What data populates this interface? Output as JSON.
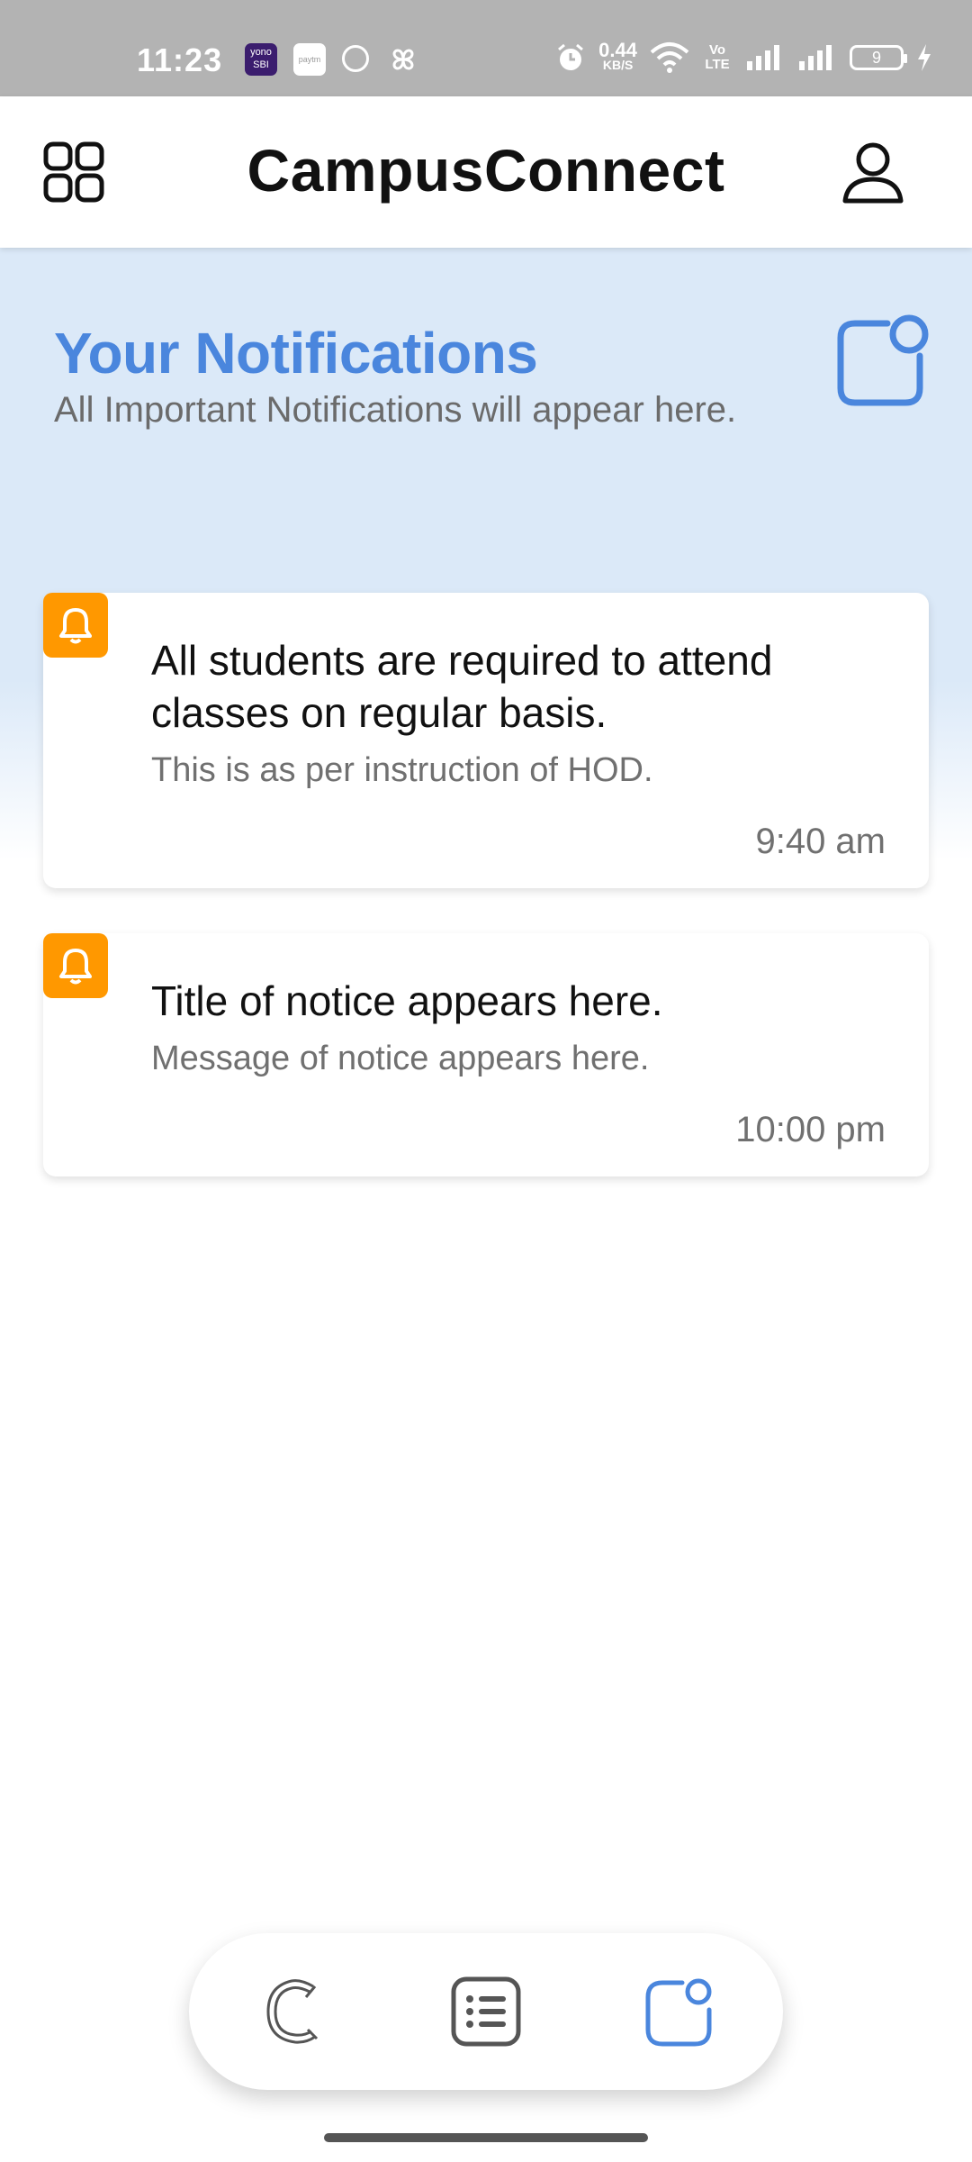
{
  "status_bar": {
    "time": "11:23",
    "yono_label": "yono SBI",
    "paytm_label": "paytm",
    "network_speed": "0.44",
    "network_unit": "KB/S",
    "volte": "Vo LTE",
    "battery": "9"
  },
  "app_bar": {
    "title": "CampusConnect",
    "menu_icon": "grid-icon",
    "profile_icon": "user-icon"
  },
  "header": {
    "title": "Your Notifications",
    "subtitle": "All Important Notifications will appear here.",
    "icon": "notification-icon"
  },
  "notifications": [
    {
      "title": "All students are required to attend classes on regular basis.",
      "message": "This is as per instruction of HOD.",
      "time": "9:40 am",
      "icon": "bell-icon"
    },
    {
      "title": "Title of notice appears here.",
      "message": "Message of notice appears here.",
      "time": "10:00 pm",
      "icon": "bell-icon"
    }
  ],
  "bottom_nav": [
    {
      "icon": "campus-logo-icon",
      "active": false
    },
    {
      "icon": "list-icon",
      "active": false
    },
    {
      "icon": "notification-icon",
      "active": true
    }
  ],
  "colors": {
    "accent": "#4a86dd",
    "bell": "#ff9800",
    "header_bg": "#dbe9f8",
    "status_bar": "#b3b3b3"
  }
}
